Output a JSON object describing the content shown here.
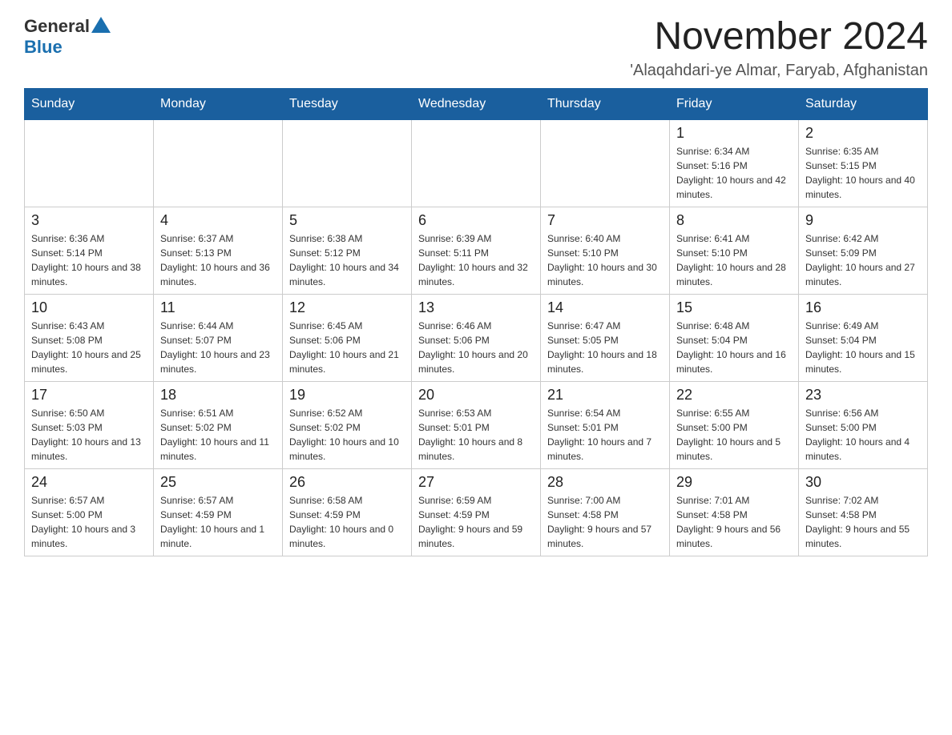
{
  "header": {
    "logo_general": "General",
    "logo_blue": "Blue",
    "month_year": "November 2024",
    "location": "'Alaqahdari-ye Almar, Faryab, Afghanistan"
  },
  "weekdays": [
    "Sunday",
    "Monday",
    "Tuesday",
    "Wednesday",
    "Thursday",
    "Friday",
    "Saturday"
  ],
  "weeks": [
    [
      {
        "day": "",
        "info": ""
      },
      {
        "day": "",
        "info": ""
      },
      {
        "day": "",
        "info": ""
      },
      {
        "day": "",
        "info": ""
      },
      {
        "day": "",
        "info": ""
      },
      {
        "day": "1",
        "info": "Sunrise: 6:34 AM\nSunset: 5:16 PM\nDaylight: 10 hours and 42 minutes."
      },
      {
        "day": "2",
        "info": "Sunrise: 6:35 AM\nSunset: 5:15 PM\nDaylight: 10 hours and 40 minutes."
      }
    ],
    [
      {
        "day": "3",
        "info": "Sunrise: 6:36 AM\nSunset: 5:14 PM\nDaylight: 10 hours and 38 minutes."
      },
      {
        "day": "4",
        "info": "Sunrise: 6:37 AM\nSunset: 5:13 PM\nDaylight: 10 hours and 36 minutes."
      },
      {
        "day": "5",
        "info": "Sunrise: 6:38 AM\nSunset: 5:12 PM\nDaylight: 10 hours and 34 minutes."
      },
      {
        "day": "6",
        "info": "Sunrise: 6:39 AM\nSunset: 5:11 PM\nDaylight: 10 hours and 32 minutes."
      },
      {
        "day": "7",
        "info": "Sunrise: 6:40 AM\nSunset: 5:10 PM\nDaylight: 10 hours and 30 minutes."
      },
      {
        "day": "8",
        "info": "Sunrise: 6:41 AM\nSunset: 5:10 PM\nDaylight: 10 hours and 28 minutes."
      },
      {
        "day": "9",
        "info": "Sunrise: 6:42 AM\nSunset: 5:09 PM\nDaylight: 10 hours and 27 minutes."
      }
    ],
    [
      {
        "day": "10",
        "info": "Sunrise: 6:43 AM\nSunset: 5:08 PM\nDaylight: 10 hours and 25 minutes."
      },
      {
        "day": "11",
        "info": "Sunrise: 6:44 AM\nSunset: 5:07 PM\nDaylight: 10 hours and 23 minutes."
      },
      {
        "day": "12",
        "info": "Sunrise: 6:45 AM\nSunset: 5:06 PM\nDaylight: 10 hours and 21 minutes."
      },
      {
        "day": "13",
        "info": "Sunrise: 6:46 AM\nSunset: 5:06 PM\nDaylight: 10 hours and 20 minutes."
      },
      {
        "day": "14",
        "info": "Sunrise: 6:47 AM\nSunset: 5:05 PM\nDaylight: 10 hours and 18 minutes."
      },
      {
        "day": "15",
        "info": "Sunrise: 6:48 AM\nSunset: 5:04 PM\nDaylight: 10 hours and 16 minutes."
      },
      {
        "day": "16",
        "info": "Sunrise: 6:49 AM\nSunset: 5:04 PM\nDaylight: 10 hours and 15 minutes."
      }
    ],
    [
      {
        "day": "17",
        "info": "Sunrise: 6:50 AM\nSunset: 5:03 PM\nDaylight: 10 hours and 13 minutes."
      },
      {
        "day": "18",
        "info": "Sunrise: 6:51 AM\nSunset: 5:02 PM\nDaylight: 10 hours and 11 minutes."
      },
      {
        "day": "19",
        "info": "Sunrise: 6:52 AM\nSunset: 5:02 PM\nDaylight: 10 hours and 10 minutes."
      },
      {
        "day": "20",
        "info": "Sunrise: 6:53 AM\nSunset: 5:01 PM\nDaylight: 10 hours and 8 minutes."
      },
      {
        "day": "21",
        "info": "Sunrise: 6:54 AM\nSunset: 5:01 PM\nDaylight: 10 hours and 7 minutes."
      },
      {
        "day": "22",
        "info": "Sunrise: 6:55 AM\nSunset: 5:00 PM\nDaylight: 10 hours and 5 minutes."
      },
      {
        "day": "23",
        "info": "Sunrise: 6:56 AM\nSunset: 5:00 PM\nDaylight: 10 hours and 4 minutes."
      }
    ],
    [
      {
        "day": "24",
        "info": "Sunrise: 6:57 AM\nSunset: 5:00 PM\nDaylight: 10 hours and 3 minutes."
      },
      {
        "day": "25",
        "info": "Sunrise: 6:57 AM\nSunset: 4:59 PM\nDaylight: 10 hours and 1 minute."
      },
      {
        "day": "26",
        "info": "Sunrise: 6:58 AM\nSunset: 4:59 PM\nDaylight: 10 hours and 0 minutes."
      },
      {
        "day": "27",
        "info": "Sunrise: 6:59 AM\nSunset: 4:59 PM\nDaylight: 9 hours and 59 minutes."
      },
      {
        "day": "28",
        "info": "Sunrise: 7:00 AM\nSunset: 4:58 PM\nDaylight: 9 hours and 57 minutes."
      },
      {
        "day": "29",
        "info": "Sunrise: 7:01 AM\nSunset: 4:58 PM\nDaylight: 9 hours and 56 minutes."
      },
      {
        "day": "30",
        "info": "Sunrise: 7:02 AM\nSunset: 4:58 PM\nDaylight: 9 hours and 55 minutes."
      }
    ]
  ]
}
